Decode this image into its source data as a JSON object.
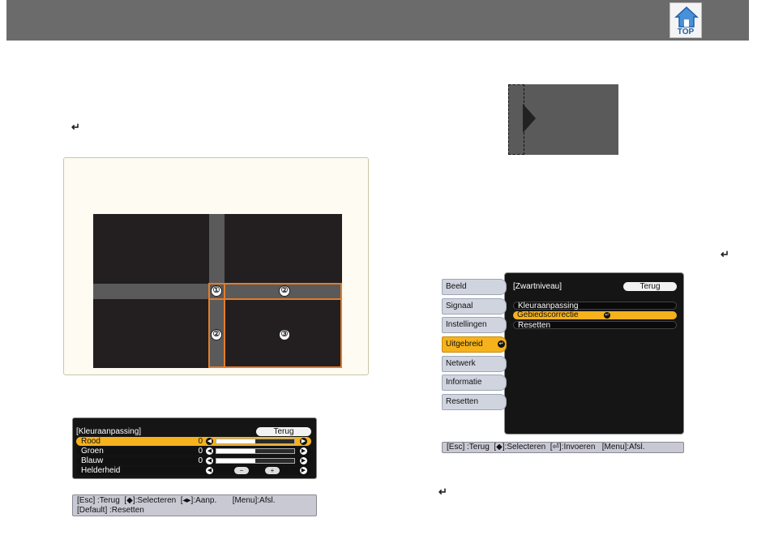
{
  "header": {
    "top_label": "TOP",
    "background": "#6b6b6b"
  },
  "enter_glyph": "↵",
  "diagram": {
    "markers": [
      "①",
      "②",
      "②",
      "③"
    ],
    "highlight_color": "#e37c2c"
  },
  "color_adjust_menu": {
    "title": "[Kleuraanpassing]",
    "back_label": "Terug",
    "rows": [
      {
        "label": "Rood",
        "value": "0",
        "level": 0.5
      },
      {
        "label": "Groen",
        "value": "0",
        "level": 0.5
      },
      {
        "label": "Blauw",
        "value": "0",
        "level": 0.5
      },
      {
        "label": "Helderheid",
        "minus": "−",
        "plus": "+"
      }
    ],
    "hint_line1": "[Esc] :Terug  [◆]:Selecteren  [◂▸]:Aanp.       [Menu]:Afsl.",
    "hint_line2": "[Default] :Resetten"
  },
  "extended_menu": {
    "tabs": [
      "Beeld",
      "Signaal",
      "Instellingen",
      "Uitgebreid",
      "Netwerk",
      "Informatie",
      "Resetten"
    ],
    "active_tab": "Uitgebreid",
    "title": "[Zwartniveau]",
    "back_label": "Terug",
    "items": [
      "Kleuraanpassing",
      "Gebiedscorrectie",
      "Resetten"
    ],
    "selected_item": "Gebiedscorrectie",
    "hint": "[Esc] :Terug  [◆]:Selecteren  [⏎]:Invoeren   [Menu]:Afsl."
  },
  "colors": {
    "accent": "#f5b21c",
    "menu_bg": "#151515",
    "tab_bg": "#cfd4df"
  }
}
